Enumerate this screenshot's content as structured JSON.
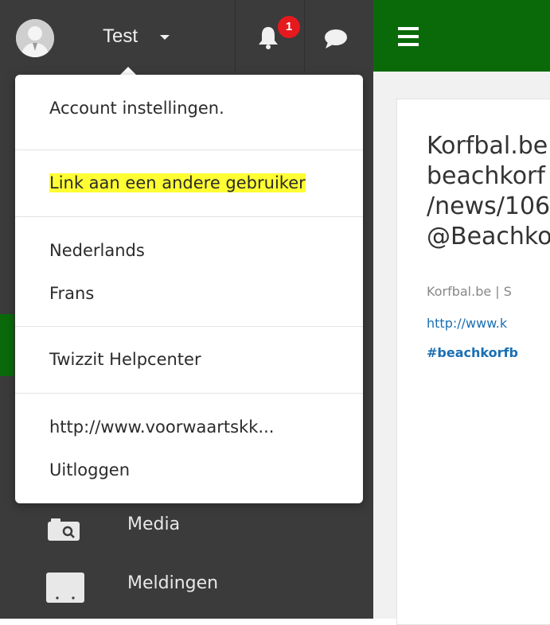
{
  "topbar": {
    "user_name": "Test",
    "notification_count": "1",
    "accent_color": "#0a6a0a",
    "dark_color": "#3b3b3b",
    "badge_color": "#e6191e"
  },
  "dropdown": {
    "items": [
      {
        "label": "Account instellingen."
      },
      {
        "label": "Link aan een andere gebruiker"
      },
      {
        "label": "Nederlands"
      },
      {
        "label": "Frans"
      },
      {
        "label": "Twizzit Helpcenter"
      },
      {
        "label": "http://www.voorwaartskk..."
      },
      {
        "label": "Uitloggen"
      }
    ],
    "highlight_color": "#ffff33"
  },
  "sidebar": {
    "items": [
      {
        "label": "Media",
        "icon": "media-search-icon"
      },
      {
        "label": "Meldingen",
        "icon": "notifications-board-icon"
      }
    ]
  },
  "content": {
    "title": "Korfbal.be\nbeachkorf\n/news/106\n@Beachko",
    "source": "Korfbal.be | S",
    "link": "http://www.k",
    "tag": "#beachkorfb"
  }
}
